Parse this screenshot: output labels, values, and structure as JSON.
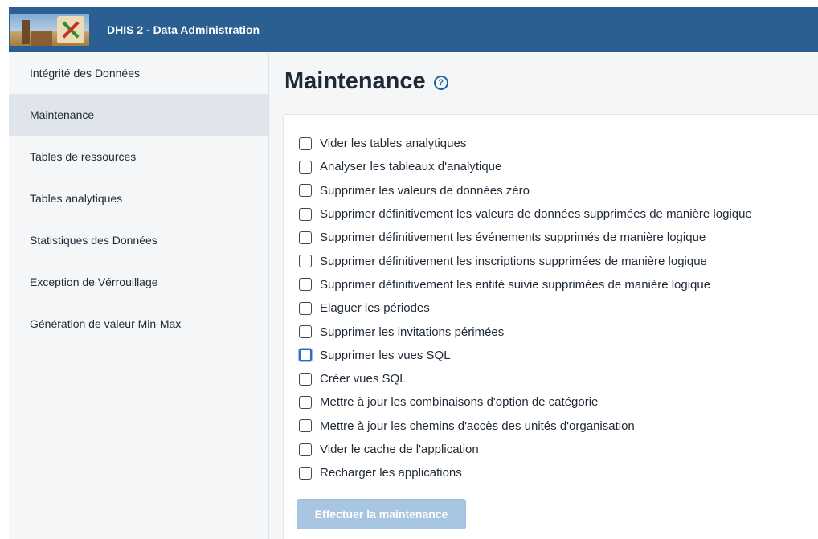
{
  "header": {
    "app_title": "DHIS 2 - Data Administration",
    "logo_icon": "niger-flag-emblem-logo"
  },
  "sidebar": {
    "items": [
      {
        "label": "Intégrité des Données",
        "active": false
      },
      {
        "label": "Maintenance",
        "active": true
      },
      {
        "label": "Tables de ressources",
        "active": false
      },
      {
        "label": "Tables analytiques",
        "active": false
      },
      {
        "label": "Statistiques des Données",
        "active": false
      },
      {
        "label": "Exception de Vérrouillage",
        "active": false
      },
      {
        "label": "Génération de valeur Min-Max",
        "active": false
      }
    ]
  },
  "main": {
    "title": "Maintenance",
    "help_icon": "help-circle-icon",
    "options": [
      {
        "label": "Vider les tables analytiques",
        "checked": false
      },
      {
        "label": "Analyser les tableaux d'analytique",
        "checked": false
      },
      {
        "label": "Supprimer les valeurs de données zéro",
        "checked": false
      },
      {
        "label": "Supprimer définitivement les valeurs de données supprimées de manière logique",
        "checked": false
      },
      {
        "label": "Supprimer définitivement les événements supprimés de manière logique",
        "checked": false
      },
      {
        "label": "Supprimer définitivement les inscriptions supprimées de manière logique",
        "checked": false
      },
      {
        "label": "Supprimer définitivement les entité suivie supprimées de manière logique",
        "checked": false
      },
      {
        "label": "Elaguer les périodes",
        "checked": false
      },
      {
        "label": "Supprimer les invitations périmées",
        "checked": false
      },
      {
        "label": "Supprimer les vues SQL",
        "checked": false,
        "focused": true
      },
      {
        "label": "Créer vues SQL",
        "checked": false
      },
      {
        "label": "Mettre à jour les combinaisons d'option de catégorie",
        "checked": false
      },
      {
        "label": "Mettre à jour les chemins d'accès des unités d'organisation",
        "checked": false
      },
      {
        "label": "Vider le cache de l'application",
        "checked": false
      },
      {
        "label": "Recharger les applications",
        "checked": false
      }
    ],
    "run_button": {
      "label": "Effectuer la maintenance",
      "disabled": true
    }
  },
  "colors": {
    "topbar": "#2b5f91",
    "sidebar_active": "#dfe5eb",
    "button_disabled": "#a8c5e2",
    "focus_ring": "#2c6cc4"
  }
}
